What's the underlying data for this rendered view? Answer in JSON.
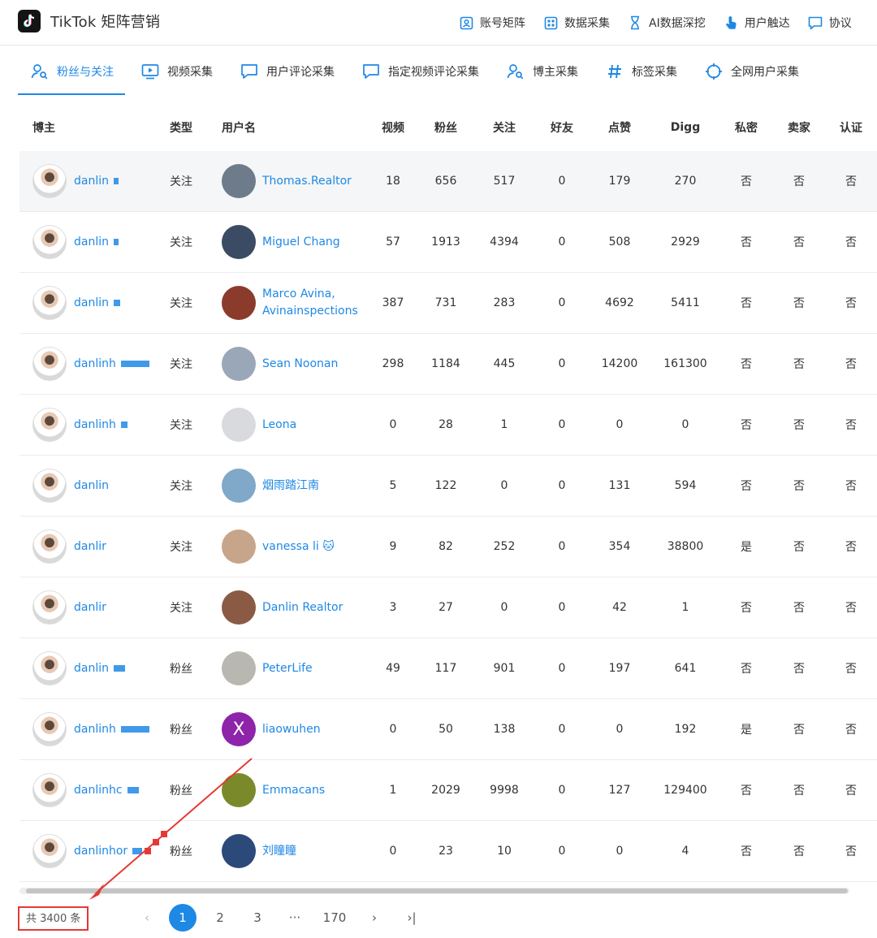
{
  "app": {
    "title": "TikTok 矩阵营销"
  },
  "topnav": [
    {
      "label": "账号矩阵",
      "icon": "account-matrix-icon"
    },
    {
      "label": "数据采集",
      "icon": "data-grid-icon"
    },
    {
      "label": "AI数据深挖",
      "icon": "hourglass-icon"
    },
    {
      "label": "用户触达",
      "icon": "touch-hand-icon"
    },
    {
      "label": "协议",
      "icon": "chat-bubble-icon"
    }
  ],
  "tabs": [
    {
      "label": "粉丝与关注",
      "icon": "user-search-icon",
      "active": true
    },
    {
      "label": "视频采集",
      "icon": "video-play-icon"
    },
    {
      "label": "用户评论采集",
      "icon": "comment-icon"
    },
    {
      "label": "指定视频评论采集",
      "icon": "comment-icon"
    },
    {
      "label": "博主采集",
      "icon": "user-search-icon"
    },
    {
      "label": "标签采集",
      "icon": "hashtag-icon"
    },
    {
      "label": "全网用户采集",
      "icon": "target-icon"
    }
  ],
  "table": {
    "headers": {
      "blogger": "博主",
      "type": "类型",
      "username": "用户名",
      "videos": "视频",
      "fans": "粉丝",
      "following": "关注",
      "friends": "好友",
      "likes": "点赞",
      "digg": "Digg",
      "private": "私密",
      "seller": "卖家",
      "verified": "认证"
    },
    "rows": [
      {
        "blogger": "danlin",
        "type": "关注",
        "username": "Thomas.Realtor",
        "videos": "18",
        "fans": "656",
        "following": "517",
        "friends": "0",
        "likes": "179",
        "digg": "270",
        "private": "否",
        "seller": "否",
        "verified": "否"
      },
      {
        "blogger": "danlin",
        "type": "关注",
        "username": "Miguel Chang",
        "videos": "57",
        "fans": "1913",
        "following": "4394",
        "friends": "0",
        "likes": "508",
        "digg": "2929",
        "private": "否",
        "seller": "否",
        "verified": "否"
      },
      {
        "blogger": "danlin",
        "type": "关注",
        "username": "Marco Avina, Avinainspections",
        "videos": "387",
        "fans": "731",
        "following": "283",
        "friends": "0",
        "likes": "4692",
        "digg": "5411",
        "private": "否",
        "seller": "否",
        "verified": "否"
      },
      {
        "blogger": "danlinh",
        "type": "关注",
        "username": "Sean  Noonan",
        "videos": "298",
        "fans": "1184",
        "following": "445",
        "friends": "0",
        "likes": "14200",
        "digg": "161300",
        "private": "否",
        "seller": "否",
        "verified": "否"
      },
      {
        "blogger": "danlinh",
        "type": "关注",
        "username": "Leona",
        "videos": "0",
        "fans": "28",
        "following": "1",
        "friends": "0",
        "likes": "0",
        "digg": "0",
        "private": "否",
        "seller": "否",
        "verified": "否"
      },
      {
        "blogger": "danlin",
        "type": "关注",
        "username": "烟雨踏江南",
        "videos": "5",
        "fans": "122",
        "following": "0",
        "friends": "0",
        "likes": "131",
        "digg": "594",
        "private": "否",
        "seller": "否",
        "verified": "否"
      },
      {
        "blogger": "danlir",
        "type": "关注",
        "username": "vanessa li 🐱",
        "videos": "9",
        "fans": "82",
        "following": "252",
        "friends": "0",
        "likes": "354",
        "digg": "38800",
        "private": "是",
        "seller": "否",
        "verified": "否"
      },
      {
        "blogger": "danlir",
        "type": "关注",
        "username": "Danlin Realtor",
        "videos": "3",
        "fans": "27",
        "following": "0",
        "friends": "0",
        "likes": "42",
        "digg": "1",
        "private": "否",
        "seller": "否",
        "verified": "否"
      },
      {
        "blogger": "danlin",
        "type": "粉丝",
        "username": "PeterLife",
        "videos": "49",
        "fans": "117",
        "following": "901",
        "friends": "0",
        "likes": "197",
        "digg": "641",
        "private": "否",
        "seller": "否",
        "verified": "否"
      },
      {
        "blogger": "danlinh",
        "type": "粉丝",
        "username": "liaowuhen",
        "videos": "0",
        "fans": "50",
        "following": "138",
        "friends": "0",
        "likes": "0",
        "digg": "192",
        "private": "是",
        "seller": "否",
        "verified": "否"
      },
      {
        "blogger": "danlinhc",
        "type": "粉丝",
        "username": "Emmacans",
        "videos": "1",
        "fans": "2029",
        "following": "9998",
        "friends": "0",
        "likes": "127",
        "digg": "129400",
        "private": "否",
        "seller": "否",
        "verified": "否"
      },
      {
        "blogger": "danlinhor",
        "type": "粉丝",
        "username": "刘瞳瞳",
        "videos": "0",
        "fans": "23",
        "following": "10",
        "friends": "0",
        "likes": "0",
        "digg": "4",
        "private": "否",
        "seller": "否",
        "verified": "否"
      }
    ],
    "avatar_letter": "X"
  },
  "pagination": {
    "total_label": "共 3400 条",
    "pages": [
      "1",
      "2",
      "3",
      "···",
      "170"
    ],
    "current": "1",
    "prev_glyph": "‹",
    "next_glyph": "›",
    "last_glyph": "›|"
  },
  "colors": {
    "accent": "#1e88e5",
    "annotation": "#e53935",
    "row_hover": "#f5f6f7"
  }
}
